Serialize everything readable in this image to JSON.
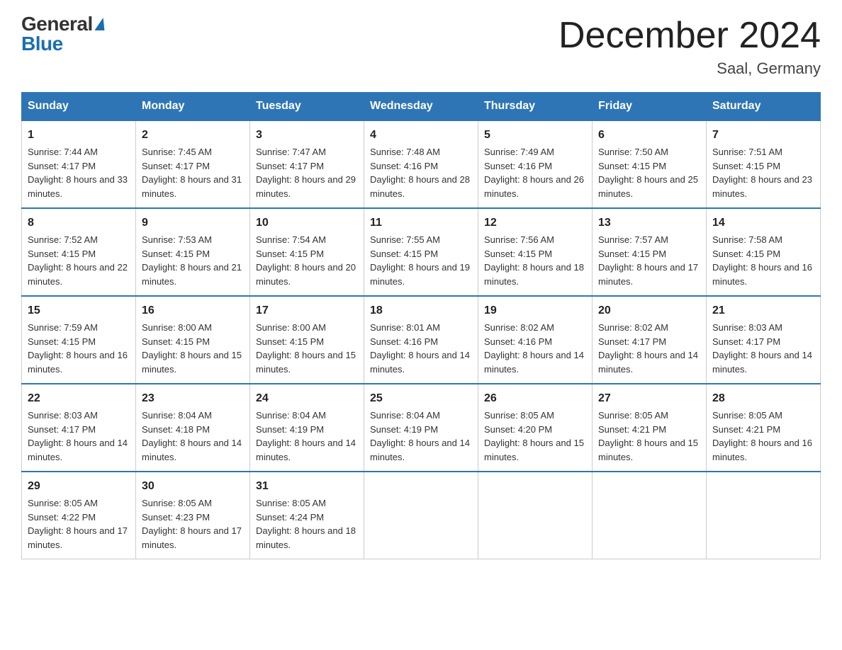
{
  "logo": {
    "general": "General",
    "blue": "Blue"
  },
  "title": "December 2024",
  "location": "Saal, Germany",
  "days": [
    "Sunday",
    "Monday",
    "Tuesday",
    "Wednesday",
    "Thursday",
    "Friday",
    "Saturday"
  ],
  "weeks": [
    [
      {
        "day": "1",
        "sunrise": "7:44 AM",
        "sunset": "4:17 PM",
        "daylight": "8 hours and 33 minutes."
      },
      {
        "day": "2",
        "sunrise": "7:45 AM",
        "sunset": "4:17 PM",
        "daylight": "8 hours and 31 minutes."
      },
      {
        "day": "3",
        "sunrise": "7:47 AM",
        "sunset": "4:17 PM",
        "daylight": "8 hours and 29 minutes."
      },
      {
        "day": "4",
        "sunrise": "7:48 AM",
        "sunset": "4:16 PM",
        "daylight": "8 hours and 28 minutes."
      },
      {
        "day": "5",
        "sunrise": "7:49 AM",
        "sunset": "4:16 PM",
        "daylight": "8 hours and 26 minutes."
      },
      {
        "day": "6",
        "sunrise": "7:50 AM",
        "sunset": "4:15 PM",
        "daylight": "8 hours and 25 minutes."
      },
      {
        "day": "7",
        "sunrise": "7:51 AM",
        "sunset": "4:15 PM",
        "daylight": "8 hours and 23 minutes."
      }
    ],
    [
      {
        "day": "8",
        "sunrise": "7:52 AM",
        "sunset": "4:15 PM",
        "daylight": "8 hours and 22 minutes."
      },
      {
        "day": "9",
        "sunrise": "7:53 AM",
        "sunset": "4:15 PM",
        "daylight": "8 hours and 21 minutes."
      },
      {
        "day": "10",
        "sunrise": "7:54 AM",
        "sunset": "4:15 PM",
        "daylight": "8 hours and 20 minutes."
      },
      {
        "day": "11",
        "sunrise": "7:55 AM",
        "sunset": "4:15 PM",
        "daylight": "8 hours and 19 minutes."
      },
      {
        "day": "12",
        "sunrise": "7:56 AM",
        "sunset": "4:15 PM",
        "daylight": "8 hours and 18 minutes."
      },
      {
        "day": "13",
        "sunrise": "7:57 AM",
        "sunset": "4:15 PM",
        "daylight": "8 hours and 17 minutes."
      },
      {
        "day": "14",
        "sunrise": "7:58 AM",
        "sunset": "4:15 PM",
        "daylight": "8 hours and 16 minutes."
      }
    ],
    [
      {
        "day": "15",
        "sunrise": "7:59 AM",
        "sunset": "4:15 PM",
        "daylight": "8 hours and 16 minutes."
      },
      {
        "day": "16",
        "sunrise": "8:00 AM",
        "sunset": "4:15 PM",
        "daylight": "8 hours and 15 minutes."
      },
      {
        "day": "17",
        "sunrise": "8:00 AM",
        "sunset": "4:15 PM",
        "daylight": "8 hours and 15 minutes."
      },
      {
        "day": "18",
        "sunrise": "8:01 AM",
        "sunset": "4:16 PM",
        "daylight": "8 hours and 14 minutes."
      },
      {
        "day": "19",
        "sunrise": "8:02 AM",
        "sunset": "4:16 PM",
        "daylight": "8 hours and 14 minutes."
      },
      {
        "day": "20",
        "sunrise": "8:02 AM",
        "sunset": "4:17 PM",
        "daylight": "8 hours and 14 minutes."
      },
      {
        "day": "21",
        "sunrise": "8:03 AM",
        "sunset": "4:17 PM",
        "daylight": "8 hours and 14 minutes."
      }
    ],
    [
      {
        "day": "22",
        "sunrise": "8:03 AM",
        "sunset": "4:17 PM",
        "daylight": "8 hours and 14 minutes."
      },
      {
        "day": "23",
        "sunrise": "8:04 AM",
        "sunset": "4:18 PM",
        "daylight": "8 hours and 14 minutes."
      },
      {
        "day": "24",
        "sunrise": "8:04 AM",
        "sunset": "4:19 PM",
        "daylight": "8 hours and 14 minutes."
      },
      {
        "day": "25",
        "sunrise": "8:04 AM",
        "sunset": "4:19 PM",
        "daylight": "8 hours and 14 minutes."
      },
      {
        "day": "26",
        "sunrise": "8:05 AM",
        "sunset": "4:20 PM",
        "daylight": "8 hours and 15 minutes."
      },
      {
        "day": "27",
        "sunrise": "8:05 AM",
        "sunset": "4:21 PM",
        "daylight": "8 hours and 15 minutes."
      },
      {
        "day": "28",
        "sunrise": "8:05 AM",
        "sunset": "4:21 PM",
        "daylight": "8 hours and 16 minutes."
      }
    ],
    [
      {
        "day": "29",
        "sunrise": "8:05 AM",
        "sunset": "4:22 PM",
        "daylight": "8 hours and 17 minutes."
      },
      {
        "day": "30",
        "sunrise": "8:05 AM",
        "sunset": "4:23 PM",
        "daylight": "8 hours and 17 minutes."
      },
      {
        "day": "31",
        "sunrise": "8:05 AM",
        "sunset": "4:24 PM",
        "daylight": "8 hours and 18 minutes."
      },
      null,
      null,
      null,
      null
    ]
  ]
}
